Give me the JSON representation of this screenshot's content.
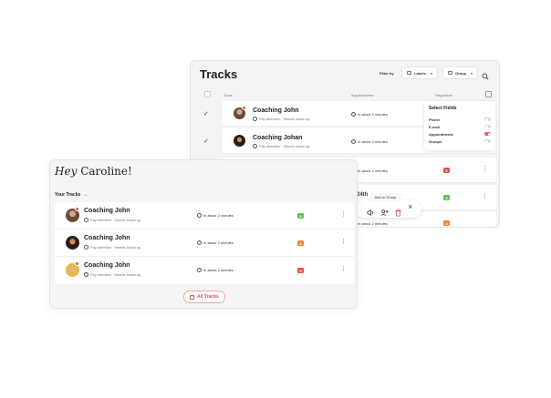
{
  "tracks_page": {
    "title": "Tracks",
    "filter_label": "Filter by",
    "filters": [
      {
        "label": "Labels"
      },
      {
        "label": "Group"
      }
    ],
    "columns": {
      "track": "Track",
      "appointments": "Appointments",
      "happiness": "Happiness"
    },
    "rows": [
      {
        "name": "Coaching John",
        "meta": "Pay attention · Needs follow up",
        "appointment": "In about 2 minutes"
      },
      {
        "name": "Coaching Johan",
        "meta": "Pay attention · Needs follow up",
        "appointment": "In about 2 minutes"
      },
      {
        "appointment": "In about 2 minutes",
        "badge": "3"
      },
      {
        "badge": "5"
      },
      {
        "appointment": "In about 2 minutes",
        "badge": "4"
      }
    ]
  },
  "select_fields": {
    "title": "Select Fields",
    "options": [
      {
        "label": "Phone",
        "enabled": false
      },
      {
        "label": "E-mail",
        "enabled": false
      },
      {
        "label": "Appointments",
        "enabled": true
      },
      {
        "label": "Groups",
        "enabled": false
      }
    ]
  },
  "action_bar": {
    "tooltip": "Add to Group",
    "partial_text": "24th"
  },
  "dashboard": {
    "greeting_prefix": "Hey",
    "greeting_name": "Caroline!",
    "section_label": "Your Tracks",
    "tracks": [
      {
        "name": "Coaching John",
        "meta": "Pay attention · Needs follow up",
        "appointment": "In about 2 minutes",
        "badge": "5",
        "badge_color": "#5cc44f"
      },
      {
        "name": "Coaching John",
        "meta": "Pay attention · Needs follow up",
        "appointment": "In about 2 minutes",
        "badge": "4",
        "badge_color": "#f0853c"
      },
      {
        "name": "Coaching John",
        "meta": "Pay attention · Needs follow up",
        "appointment": "In about 2 minutes",
        "badge": "3",
        "badge_color": "#e05250"
      }
    ],
    "all_tracks_label": "All Tracks"
  }
}
